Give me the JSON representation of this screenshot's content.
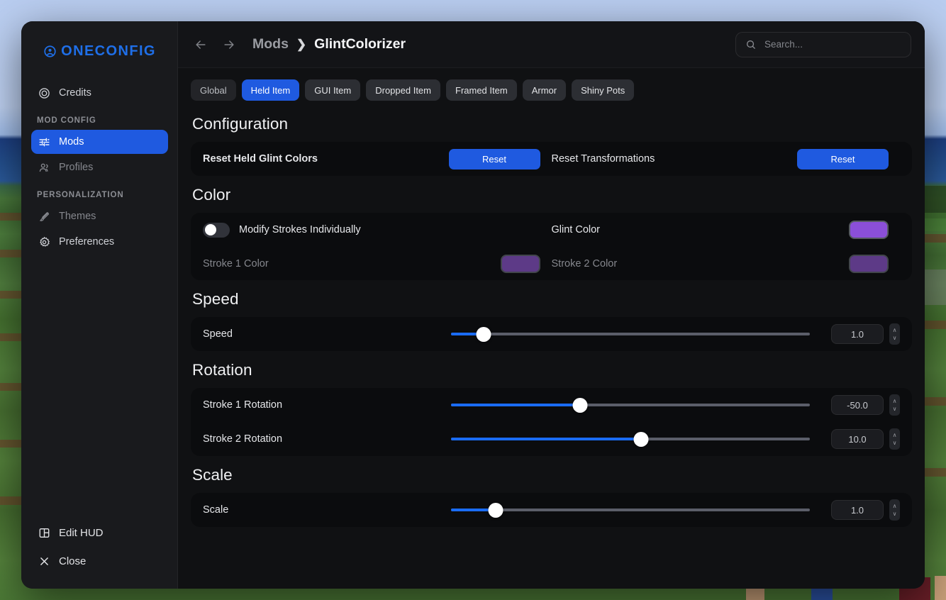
{
  "brand": {
    "name": "ONECONFIG",
    "accent": "#1f6fe8"
  },
  "sidebar": {
    "top_items": [
      {
        "label": "Credits",
        "icon": "copyright-icon"
      }
    ],
    "groups": [
      {
        "label": "MOD CONFIG",
        "items": [
          {
            "label": "Mods",
            "icon": "sliders-icon",
            "active": true
          },
          {
            "label": "Profiles",
            "icon": "users-icon",
            "active": false
          }
        ]
      },
      {
        "label": "PERSONALIZATION",
        "items": [
          {
            "label": "Themes",
            "icon": "brush-icon",
            "active": false
          },
          {
            "label": "Preferences",
            "icon": "gear-icon",
            "active": false
          }
        ]
      }
    ],
    "bottom_items": [
      {
        "label": "Edit HUD",
        "icon": "layout-icon"
      },
      {
        "label": "Close",
        "icon": "close-icon"
      }
    ]
  },
  "header": {
    "back_icon": "arrow-left-icon",
    "forward_icon": "arrow-right-icon",
    "breadcrumb": {
      "parent": "Mods",
      "separator": "❯",
      "current": "GlintColorizer"
    },
    "search": {
      "placeholder": "Search...",
      "value": "",
      "icon": "search-icon"
    }
  },
  "tabs": [
    {
      "label": "Global",
      "state": "muted"
    },
    {
      "label": "Held Item",
      "state": "active"
    },
    {
      "label": "GUI Item",
      "state": "normal"
    },
    {
      "label": "Dropped Item",
      "state": "normal"
    },
    {
      "label": "Framed Item",
      "state": "normal"
    },
    {
      "label": "Armor",
      "state": "normal"
    },
    {
      "label": "Shiny Pots",
      "state": "normal"
    }
  ],
  "colors": {
    "accent_blue": "#1f5ae0",
    "slider_blue": "#1a6cf5",
    "glint_color": "#8b4fd8",
    "stroke1_color": "#5d3a87",
    "stroke2_color": "#5d3a87"
  },
  "sections": {
    "configuration": {
      "title": "Configuration",
      "rows": [
        {
          "left": {
            "label": "Reset Held Glint Colors",
            "bold": true,
            "button": "Reset"
          },
          "right": {
            "label": "Reset Transformations",
            "bold": false,
            "button": "Reset"
          }
        }
      ]
    },
    "color": {
      "title": "Color",
      "toggle": {
        "label": "Modify Strokes Individually",
        "value": "off"
      },
      "glint": {
        "label": "Glint Color",
        "value": "#8b4fd8"
      },
      "stroke1": {
        "label": "Stroke 1 Color",
        "value": "#5d3a87",
        "disabled": true
      },
      "stroke2": {
        "label": "Stroke 2 Color",
        "value": "#5d3a87",
        "disabled": true
      }
    },
    "speed": {
      "title": "Speed",
      "slider": {
        "label": "Speed",
        "value": "1.0",
        "percent": 9
      }
    },
    "rotation": {
      "title": "Rotation",
      "sliders": [
        {
          "label": "Stroke 1 Rotation",
          "value": "-50.0",
          "percent": 36
        },
        {
          "label": "Stroke 2 Rotation",
          "value": "10.0",
          "percent": 53
        }
      ]
    },
    "scale": {
      "title": "Scale",
      "slider": {
        "label": "Scale",
        "value": "1.0",
        "percent": 12.5
      }
    }
  },
  "stepper": {
    "up": "∧",
    "down": "∨"
  }
}
